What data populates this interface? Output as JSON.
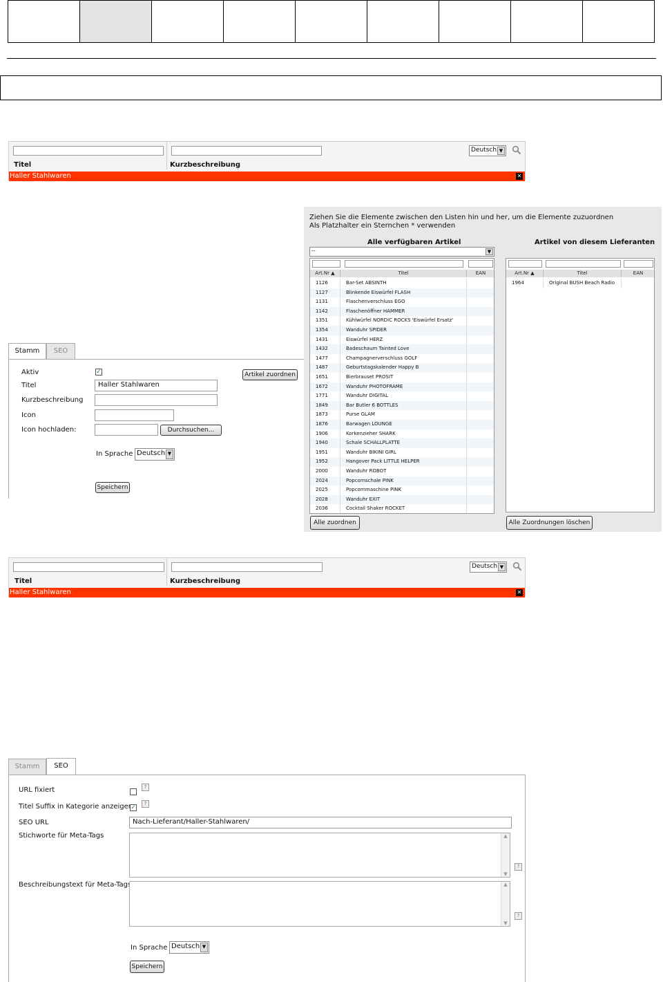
{
  "filter": {
    "col_title": "Titel",
    "col_short": "Kurzbeschreibung",
    "language": "Deutsch",
    "result": "Haller Stahlwaren"
  },
  "tabs": {
    "stamm": "Stamm",
    "seo": "SEO"
  },
  "stamm_form": {
    "aktiv_label": "Aktiv",
    "titel_label": "Titel",
    "titel_value": "Haller Stahlwaren",
    "kurz_label": "Kurzbeschreibung",
    "icon_label": "Icon",
    "upload_label": "Icon hochladen:",
    "browse_button": "Durchsuchen...",
    "lang_label": "In Sprache",
    "lang_value": "Deutsch",
    "save_button": "Speichern",
    "assign_button": "Artikel zuordnen"
  },
  "assign": {
    "hint1": "Ziehen Sie die Elemente zwischen den Listen hin und her, um die Elemente zuzuordnen",
    "hint2": "Als Platzhalter ein Sternchen * verwenden",
    "left_title": "Alle verfügbaren Artikel",
    "right_title": "Artikel von diesem Lieferanten",
    "dropdown_value": "--",
    "col_artnr": "Art.Nr",
    "col_titel": "Titel",
    "col_ean": "EAN",
    "assign_all": "Alle zuordnen",
    "clear_all": "Alle Zuordnungen löschen",
    "available": [
      [
        "1126",
        "Bar-Set ABSINTH"
      ],
      [
        "1127",
        "Blinkende Eiswürfel FLASH"
      ],
      [
        "1131",
        "Flaschenverschluss EGO"
      ],
      [
        "1142",
        "Flaschenöffner HAMMER"
      ],
      [
        "1351",
        "Kühlwürfel NORDIC ROCKS 'Eiswürfel Ersatz'"
      ],
      [
        "1354",
        "Wanduhr SPIDER"
      ],
      [
        "1431",
        "Eiswürfel HERZ"
      ],
      [
        "1432",
        "Badeschaum Tainted Love"
      ],
      [
        "1477",
        "Champagnerverschluss GOLF"
      ],
      [
        "1487",
        "Geburtstagskalender Happy B"
      ],
      [
        "1651",
        "Bierbrauset PROSIT"
      ],
      [
        "1672",
        "Wanduhr PHOTOFRAME"
      ],
      [
        "1771",
        "Wanduhr DIGITAL"
      ],
      [
        "1849",
        "Bar Butler 6 BOTTLES"
      ],
      [
        "1873",
        "Purse GLAM"
      ],
      [
        "1876",
        "Barwagen LOUNGE"
      ],
      [
        "1906",
        "Korkenzieher SHARK"
      ],
      [
        "1940",
        "Schale SCHALLPLATTE"
      ],
      [
        "1951",
        "Wanduhr BIKINI GIRL"
      ],
      [
        "1952",
        "Hangover Pack LITTLE HELPER"
      ],
      [
        "2000",
        "Wanduhr ROBOT"
      ],
      [
        "2024",
        "Popcornschale PINK"
      ],
      [
        "2025",
        "Popcornmaschine PINK"
      ],
      [
        "2028",
        "Wanduhr EXIT"
      ],
      [
        "2036",
        "Cocktail Shaker ROCKET"
      ]
    ],
    "assigned": [
      [
        "1964",
        "Original BUSH Beach Radio"
      ]
    ]
  },
  "seo_form": {
    "url_fixed_label": "URL fixiert",
    "suffix_label": "Titel Suffix in Kategorie anzeigen",
    "seo_url_label": "SEO URL",
    "seo_url_value": "Nach-Lieferant/Haller-Stahlwaren/",
    "keywords_label": "Stichworte für Meta-Tags",
    "desc_label": "Beschreibungstext für Meta-Tags",
    "lang_label": "In Sprache",
    "lang_value": "Deutsch",
    "save_button": "Speichern",
    "help": "?"
  }
}
